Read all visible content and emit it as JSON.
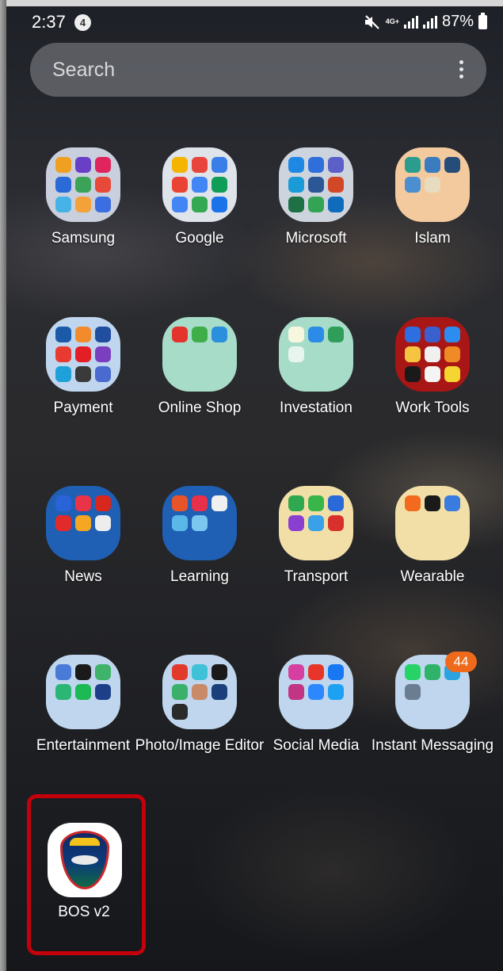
{
  "status_bar": {
    "time": "2:37",
    "notification_count": "4",
    "network_type": "4G+",
    "battery": "87%"
  },
  "search": {
    "placeholder": "Search"
  },
  "folders": [
    {
      "label": "Samsung"
    },
    {
      "label": "Google"
    },
    {
      "label": "Microsoft"
    },
    {
      "label": "Islam"
    },
    {
      "label": "Payment"
    },
    {
      "label": "Online Shop"
    },
    {
      "label": "Investation"
    },
    {
      "label": "Work Tools"
    },
    {
      "label": "News"
    },
    {
      "label": "Learning"
    },
    {
      "label": "Transport"
    },
    {
      "label": "Wearable"
    },
    {
      "label": "Entertainment"
    },
    {
      "label": "Photo/Image Editor"
    },
    {
      "label": "Social Media"
    },
    {
      "label": "Instant Messaging",
      "badge": "44"
    }
  ],
  "apps": [
    {
      "label": "BOS v2",
      "icon": "bos-logo-icon"
    }
  ],
  "icons": [
    "mute-icon",
    "signal-icon",
    "battery-icon",
    "more-vert-icon"
  ],
  "colors": {
    "highlight_border": "#c4000b",
    "badge": "#ef6a1a"
  }
}
